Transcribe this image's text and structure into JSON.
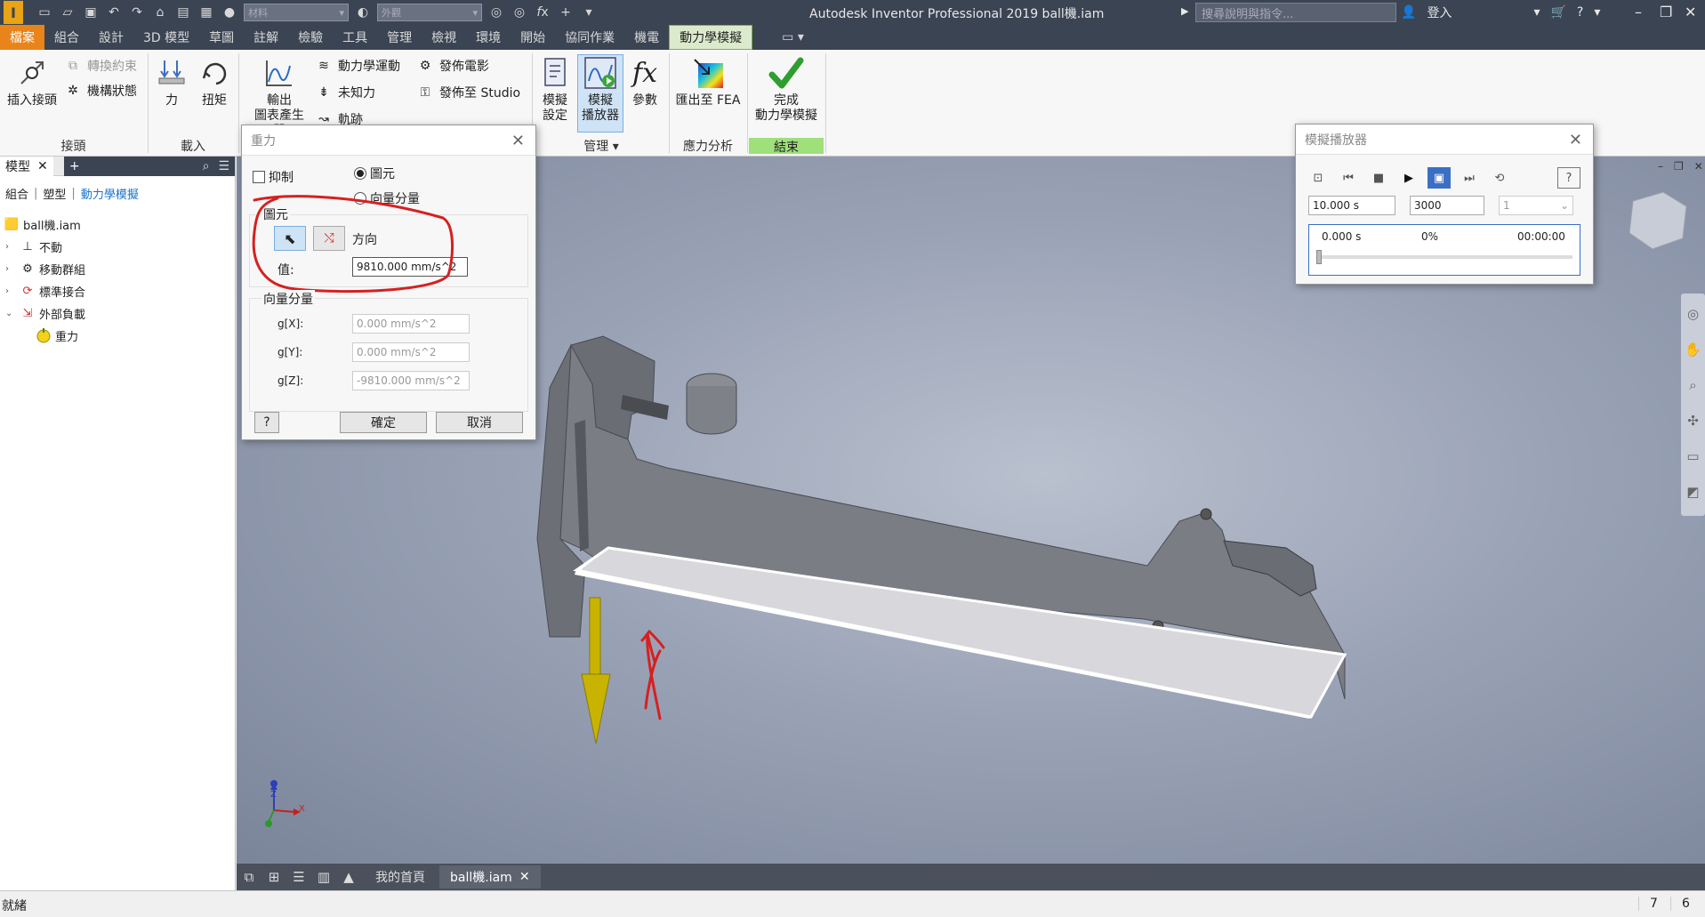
{
  "titlebar": {
    "app_title": "Autodesk Inventor Professional 2019    ball機.iam",
    "material_select": "材料",
    "appearance_select": "外觀",
    "search_placeholder": "搜尋說明與指令...",
    "login_label": "登入"
  },
  "menu_tabs": [
    "檔案",
    "組合",
    "設計",
    "3D 模型",
    "草圖",
    "註解",
    "檢驗",
    "工具",
    "管理",
    "檢視",
    "環境",
    "開始",
    "協同作業",
    "機電",
    "動力學模擬"
  ],
  "ribbon": {
    "joint": {
      "insert_joint": "插入接頭",
      "convert_constraints": "轉換約束",
      "mechanism_status": "機構狀態",
      "panel": "接頭"
    },
    "load": {
      "force": "力",
      "torque": "扭矩",
      "panel": "載入"
    },
    "results": {
      "output_grapher_1": "輸出",
      "output_grapher_2": "圖表產生器",
      "dynamic_motion": "動力學運動",
      "unknown_force": "未知力",
      "trace": "軌跡",
      "publish_movie": "發佈電影",
      "publish_studio": "發佈至 Studio"
    },
    "manage": {
      "sim_settings_1": "模擬",
      "sim_settings_2": "設定",
      "sim_player_1": "模擬",
      "sim_player_2": "播放器",
      "parameters": "參數",
      "panel": "管理 ▾"
    },
    "stress": {
      "export_fea": "匯出至 FEA",
      "panel": "應力分析"
    },
    "finish": {
      "finish_1": "完成",
      "finish_2": "動力學模擬",
      "panel": "結束"
    }
  },
  "browser": {
    "tab_label": "模型",
    "filters": [
      "組合",
      "塑型",
      "動力學模擬"
    ],
    "tree": [
      {
        "label": "ball機.iam",
        "icon": "assembly-icon"
      },
      {
        "label": "不動",
        "icon": "ground-icon"
      },
      {
        "label": "移動群組",
        "icon": "mobile-group-icon"
      },
      {
        "label": "標準接合",
        "icon": "joint-icon"
      },
      {
        "label": "外部負載",
        "icon": "external-load-icon"
      },
      {
        "label": "重力",
        "icon": "gravity-icon"
      }
    ]
  },
  "gravity_dialog": {
    "title": "重力",
    "suppress_label": "抑制",
    "radio_entity": "圖元",
    "radio_vector": "向量分量",
    "entity_group": "圖元",
    "direction_label": "方向",
    "value_label": "值:",
    "value": "9810.000 mm/s^2",
    "vector_group": "向量分量",
    "gx_label": "g[X]:",
    "gx_value": "0.000 mm/s^2",
    "gy_label": "g[Y]:",
    "gy_value": "0.000 mm/s^2",
    "gz_label": "g[Z]:",
    "gz_value": "-9810.000 mm/s^2",
    "ok": "確定",
    "cancel": "取消"
  },
  "sim_player": {
    "title": "模擬播放器",
    "end_time": "10.000 s",
    "images": "3000",
    "filter": "1",
    "current_time": "0.000 s",
    "percent": "0%",
    "clock": "00:00:00"
  },
  "view_tabs": {
    "home": "我的首頁",
    "document": "ball機.iam"
  },
  "status": {
    "left": "就緒",
    "num1": "7",
    "num2": "6"
  },
  "axis": {
    "z": "Z",
    "x": "X"
  },
  "colors": {
    "accent_orange": "#e8841a",
    "active_tab": "#dceacc",
    "finish_green": "#9ee07a",
    "annotation_red": "#d62020",
    "gravity_arrow": "#c8b400"
  }
}
